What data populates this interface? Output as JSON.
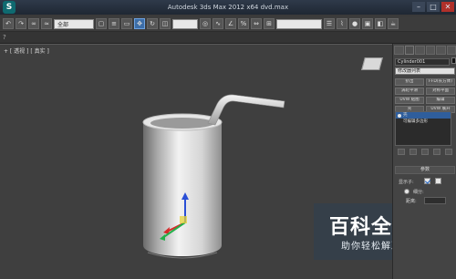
{
  "window": {
    "app_icon_label": "S",
    "title": "Autodesk 3ds Max  2012 x64    dvd.max",
    "minimize": "–",
    "maximize": "□",
    "close": "✕"
  },
  "toolbar": {
    "selection_filter": "全部",
    "named_selection": ""
  },
  "command_line": {
    "prompt_mark": "?"
  },
  "viewport": {
    "label": "+ [ 透视 ] [ 真实 ]"
  },
  "panel": {
    "object_name": "Cylinder001",
    "modifier_list": "修改器列表",
    "buttons": [
      "挤出",
      "FFD(长方体)",
      "涡轮平滑",
      "对称平面",
      "UVW 贴图",
      "编辑",
      "壳",
      "UVW 展开"
    ],
    "stack": [
      "壳",
      "可编辑多边形"
    ],
    "rollout_title": "参数",
    "param_labels": [
      "显示子:",
      "细分:",
      "距离:"
    ],
    "param_value": "1"
  },
  "watermark": {
    "title": "百科全说",
    "subtitle": "助你轻松解决"
  }
}
